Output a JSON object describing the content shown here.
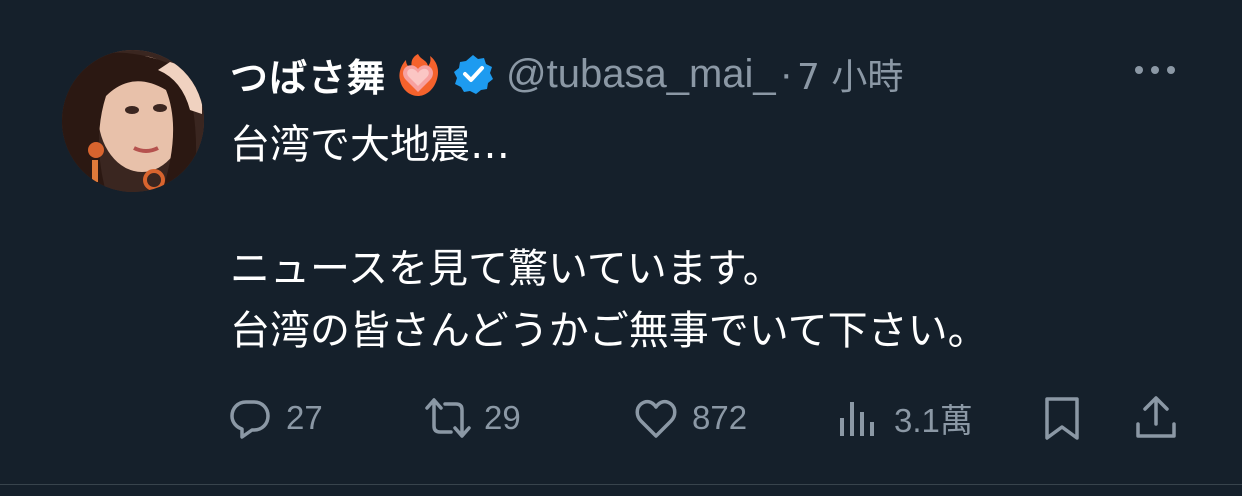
{
  "tweet": {
    "display_name": "つばさ舞",
    "handle": "@tubasa_mai_",
    "separator": "·",
    "time": "7 小時",
    "text_lines": [
      "台湾で大地震…",
      "",
      "ニュースを見て驚いています。",
      "台湾の皆さんどうかご無事でいて下さい。"
    ]
  },
  "icons": {
    "heart": "heart-on-fire-icon",
    "verified": "verified-badge-icon",
    "more": "more-options-icon"
  },
  "actions": {
    "reply": {
      "icon": "reply-icon",
      "count": "27"
    },
    "retweet": {
      "icon": "retweet-icon",
      "count": "29"
    },
    "like": {
      "icon": "like-icon",
      "count": "872"
    },
    "views": {
      "icon": "views-icon",
      "count": "3.1萬"
    },
    "bookmark": {
      "icon": "bookmark-icon"
    },
    "share": {
      "icon": "share-icon"
    }
  },
  "colors": {
    "background": "#15202b",
    "secondary_text": "#8b98a5",
    "verified_blue": "#1d9bf0",
    "primary_text": "#ffffff"
  }
}
